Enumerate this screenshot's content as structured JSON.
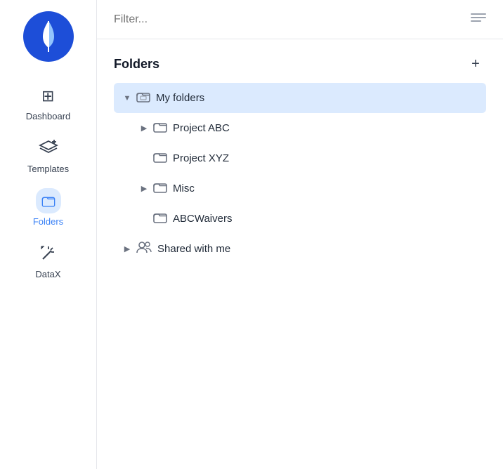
{
  "sidebar": {
    "logo_alt": "Sailboat logo",
    "items": [
      {
        "id": "dashboard",
        "label": "Dashboard",
        "active": false
      },
      {
        "id": "templates",
        "label": "Templates",
        "active": false
      },
      {
        "id": "folders",
        "label": "Folders",
        "active": true
      },
      {
        "id": "datax",
        "label": "DataX",
        "active": false
      }
    ]
  },
  "filter": {
    "placeholder": "Filter..."
  },
  "folders_section": {
    "title": "Folders",
    "add_label": "+",
    "tree": [
      {
        "id": "my-folders",
        "label": "My folders",
        "indent": 0,
        "chevron": "down",
        "icon": "folder-image",
        "highlighted": true
      },
      {
        "id": "project-abc",
        "label": "Project ABC",
        "indent": 1,
        "chevron": "right",
        "icon": "folder"
      },
      {
        "id": "project-xyz",
        "label": "Project XYZ",
        "indent": 1,
        "chevron": "none",
        "icon": "folder"
      },
      {
        "id": "misc",
        "label": "Misc",
        "indent": 1,
        "chevron": "right",
        "icon": "folder"
      },
      {
        "id": "abc-waivers",
        "label": "ABCWaivers",
        "indent": 1,
        "chevron": "none",
        "icon": "folder"
      },
      {
        "id": "shared-with-me",
        "label": "Shared with me",
        "indent": 0,
        "chevron": "right",
        "icon": "shared"
      }
    ]
  }
}
